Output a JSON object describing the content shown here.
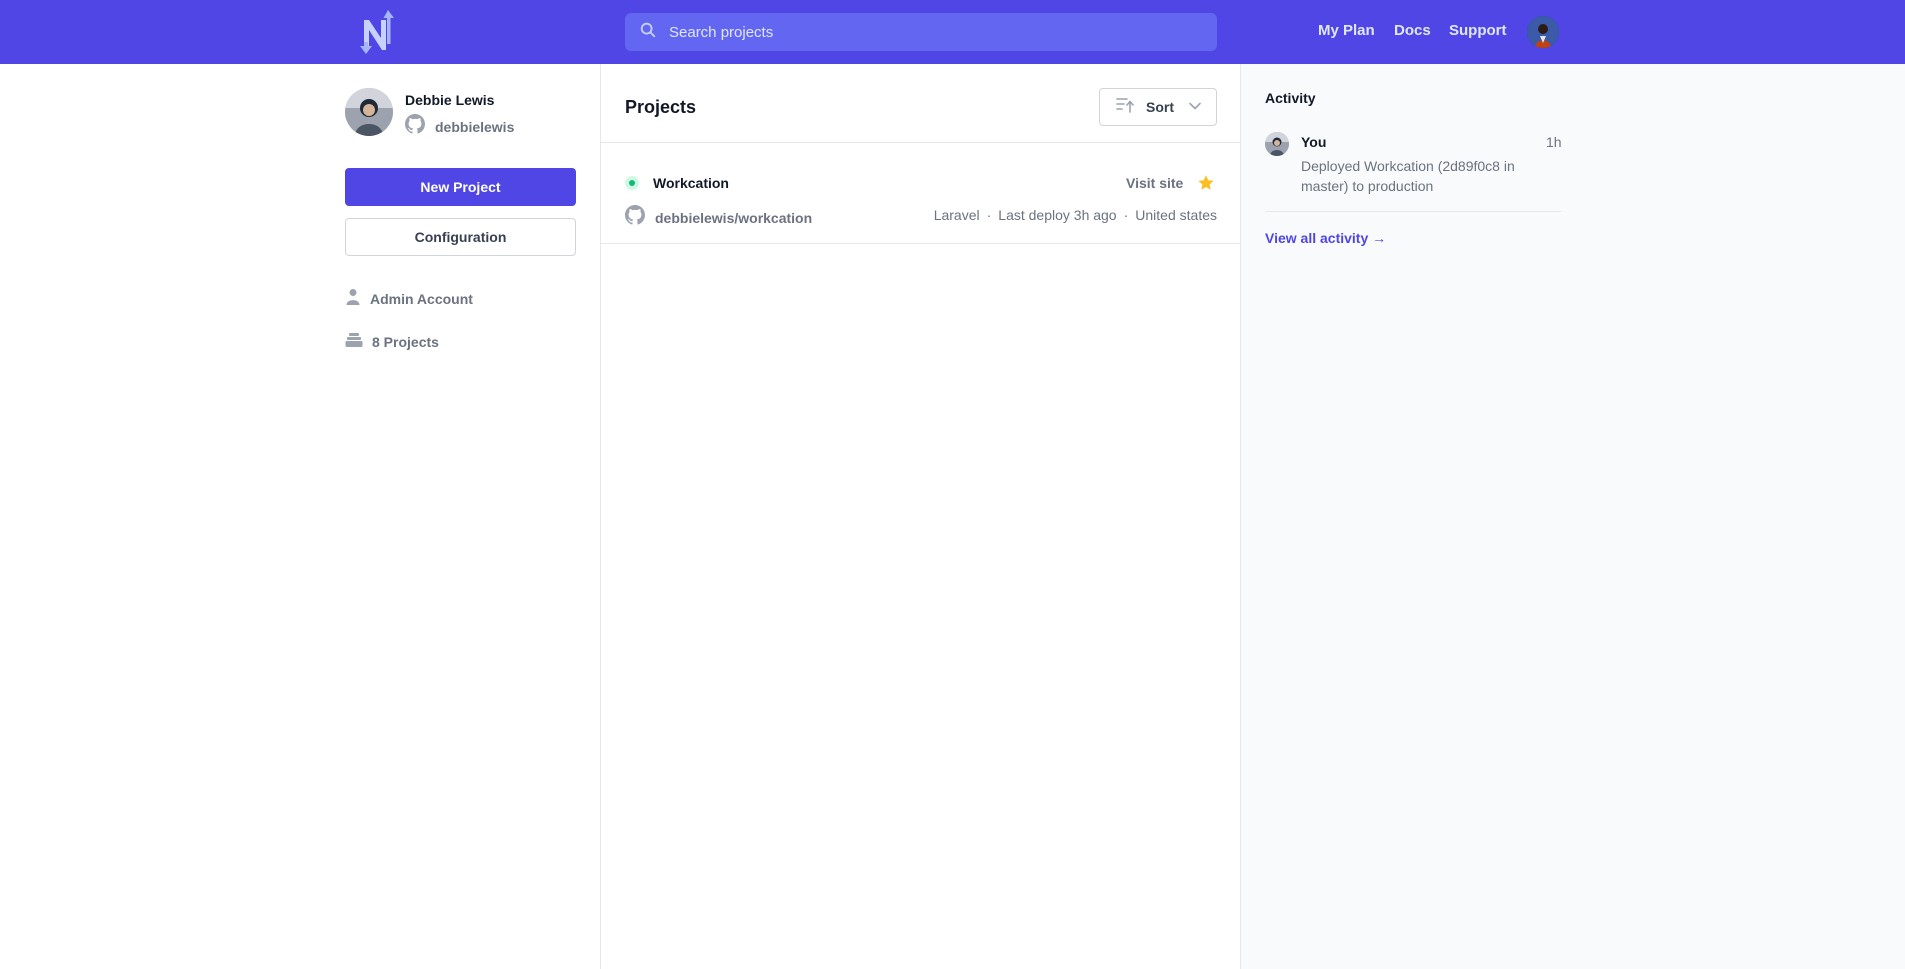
{
  "topbar": {
    "search_placeholder": "Search projects",
    "nav": {
      "my_plan": "My Plan",
      "docs": "Docs",
      "support": "Support"
    },
    "brand_color": "#4f46e5"
  },
  "profile": {
    "name": "Debbie Lewis",
    "github_handle": "debbielewis"
  },
  "sidebar": {
    "new_project": "New Project",
    "configuration": "Configuration",
    "meta": [
      {
        "icon": "user-icon",
        "label": "Admin Account"
      },
      {
        "icon": "stack-icon",
        "label": "8 Projects"
      }
    ]
  },
  "main": {
    "title": "Projects",
    "sort_label": "Sort",
    "projects": [
      {
        "name": "Workcation",
        "status_color": "#10b981",
        "visit_label": "Visit site",
        "starred": true,
        "repo": "debbielewis/workcation",
        "framework": "Laravel",
        "last_deploy": "Last deploy 3h ago",
        "region": "United states",
        "separator": "·"
      }
    ]
  },
  "activity": {
    "title": "Activity",
    "items": [
      {
        "user": "You",
        "time": "1h",
        "description": "Deployed Workcation (2d89f0c8 in master) to production"
      }
    ],
    "view_all": "View all activity →"
  }
}
